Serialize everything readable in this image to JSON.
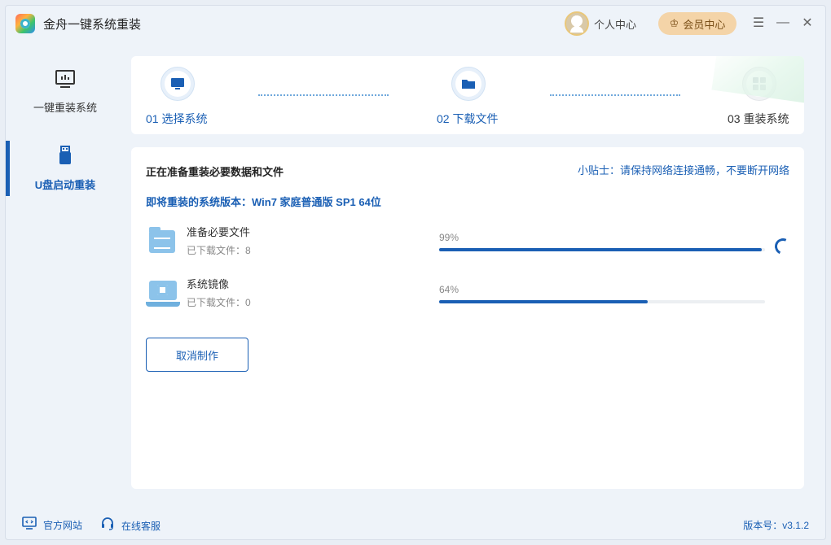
{
  "app": {
    "title": "金舟一键系统重装"
  },
  "header": {
    "user_center": "个人中心",
    "vip_center": "会员中心"
  },
  "sidebar": {
    "items": [
      {
        "label": "一键重装系统",
        "icon": "monitor-icon"
      },
      {
        "label": "U盘启动重装",
        "icon": "usb-icon",
        "active": true
      }
    ]
  },
  "steps": [
    {
      "label": "01 选择系统",
      "status": "done",
      "icon": "monitor-icon"
    },
    {
      "label": "02 下载文件",
      "status": "current",
      "icon": "folder-icon"
    },
    {
      "label": "03 重装系统",
      "status": "pending",
      "icon": "windows-icon"
    }
  ],
  "main": {
    "title": "正在准备重装必要数据和文件",
    "tip": "小贴士：请保持网络连接通畅，不要断开网络",
    "version_line": "即将重装的系统版本：Win7 家庭普通版 SP1 64位",
    "tasks": [
      {
        "name": "准备必要文件",
        "sub": "已下载文件：8",
        "percent_text": "99%",
        "progress": 0.99,
        "icon": "folder-icon"
      },
      {
        "name": "系统镜像",
        "sub": "已下载文件：0",
        "percent_text": "64%",
        "progress": 0.64,
        "icon": "laptop-icon"
      }
    ],
    "cancel_label": "取消制作"
  },
  "footer": {
    "website": "官方网站",
    "support": "在线客服",
    "version": "版本号：v3.1.2"
  },
  "colors": {
    "accent": "#1a5fb4",
    "vip": "#f4d4a8"
  }
}
